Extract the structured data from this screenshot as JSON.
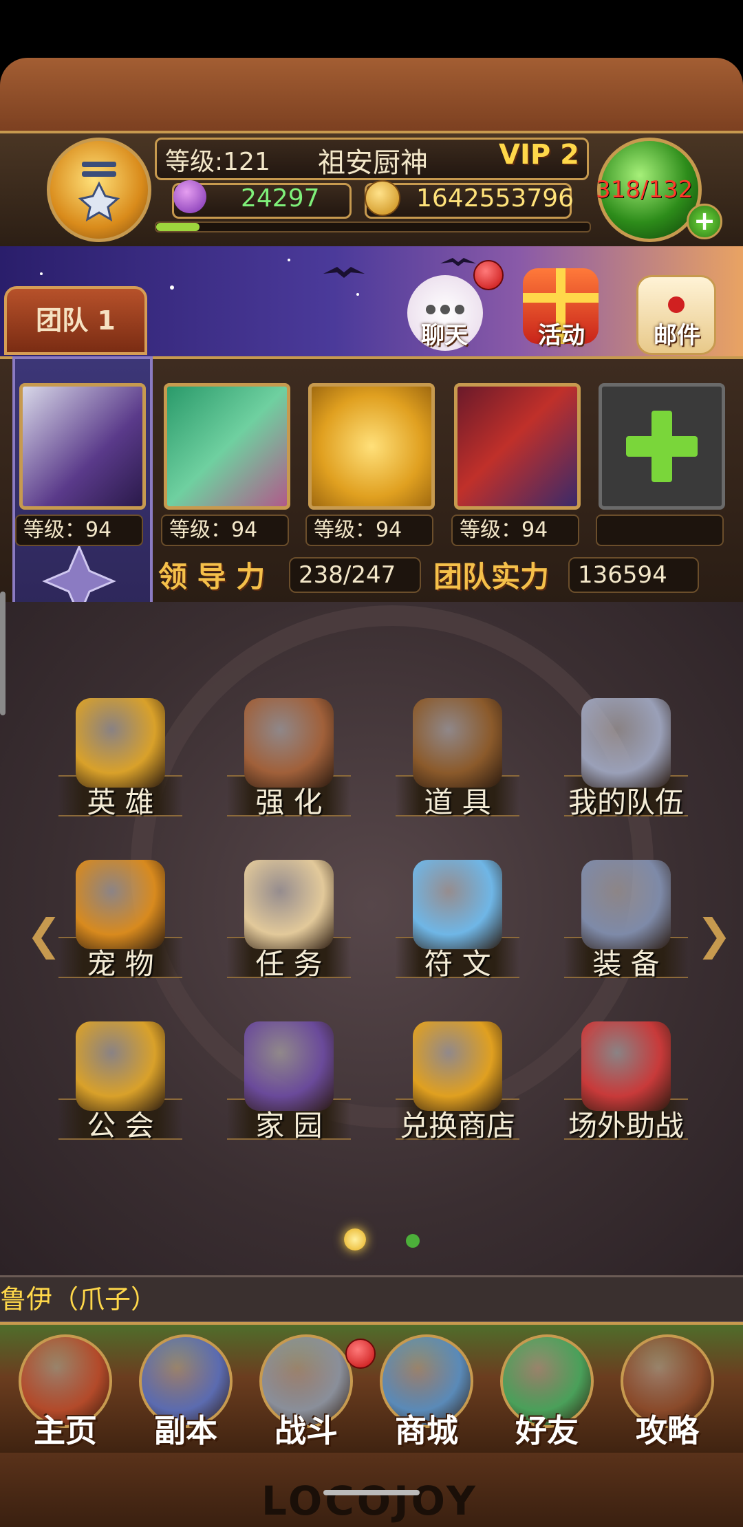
{
  "header": {
    "level_text": "等级:121",
    "player_name": "祖安厨神",
    "vip": "VIP 2",
    "gems": "24297",
    "gold": "1642553796",
    "energy": "318/132",
    "xp_progress": 0.1
  },
  "banner": {
    "chat": "聊天",
    "events": "活动",
    "mail": "邮件"
  },
  "team": {
    "tab_label": "团队 1",
    "heroes": [
      {
        "level": "等级：94"
      },
      {
        "level": "等级：94"
      },
      {
        "level": "等级：94"
      },
      {
        "level": "等级：94"
      }
    ],
    "leadership_label": "领 导 力",
    "leadership_value": "238/247",
    "power_label": "团队实力",
    "power_value": "136594"
  },
  "menu": {
    "items": [
      {
        "label": "英  雄",
        "icon": "hero-card-icon",
        "color": "#d9a12a"
      },
      {
        "label": "强  化",
        "icon": "forge-icon",
        "color": "#a0603a"
      },
      {
        "label": "道  具",
        "icon": "backpack-icon",
        "color": "#8b5a2b"
      },
      {
        "label": "我的队伍",
        "icon": "crossed-swords-icon",
        "color": "#9aa0b8"
      },
      {
        "label": "宠  物",
        "icon": "pet-icon",
        "color": "#d88a1e"
      },
      {
        "label": "任  务",
        "icon": "scroll-icon",
        "color": "#e2c99a"
      },
      {
        "label": "符  文",
        "icon": "rune-icon",
        "color": "#6fb6e6"
      },
      {
        "label": "装  备",
        "icon": "anvil-icon",
        "color": "#7e8aa8"
      },
      {
        "label": "公  会",
        "icon": "guild-shield-icon",
        "color": "#d9a12a"
      },
      {
        "label": "家  园",
        "icon": "portal-icon",
        "color": "#6a4a9a"
      },
      {
        "label": "兑换商店",
        "icon": "mystery-chest-icon",
        "color": "#e0a020"
      },
      {
        "label": "场外助战",
        "icon": "fist-flag-icon",
        "color": "#c83a3a"
      }
    ]
  },
  "pagination": {
    "current": 1,
    "total": 2
  },
  "marquee": "鲁伊（爪子）",
  "nav": [
    {
      "label": "主页",
      "icon": "house-icon",
      "color": "#b34a2a"
    },
    {
      "label": "副本",
      "icon": "skull-helmet-icon",
      "color": "#5b6bb0"
    },
    {
      "label": "战斗",
      "icon": "sword-axe-icon",
      "color": "#8a8f9a"
    },
    {
      "label": "商城",
      "icon": "monster-shop-icon",
      "color": "#5a8ab8"
    },
    {
      "label": "好友",
      "icon": "friends-icon",
      "color": "#4aa05a"
    },
    {
      "label": "攻略",
      "icon": "guide-book-icon",
      "color": "#8a4a2a"
    }
  ],
  "footer_logo": "LOCOJOY"
}
